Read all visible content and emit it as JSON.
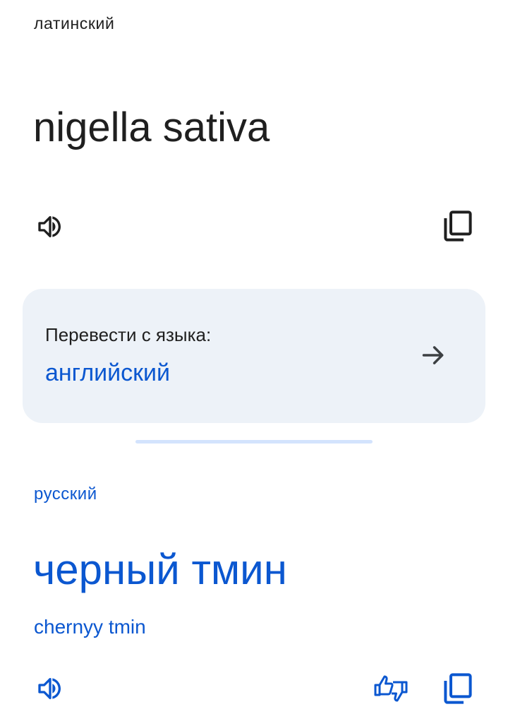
{
  "source": {
    "language": "латинский",
    "text": "nigella sativa",
    "listen_icon": "speaker-icon",
    "copy_icon": "copy-icon"
  },
  "detect": {
    "prompt": "Перевести с языка:",
    "language": "английский",
    "arrow_icon": "arrow-right-icon"
  },
  "target": {
    "language": "русский",
    "text": "черный тмин",
    "transliteration": "chernyy tmin",
    "listen_icon": "speaker-icon",
    "feedback_icon": "thumbs-up-down-icon",
    "copy_icon": "copy-icon"
  },
  "colors": {
    "accent": "#0b57d0",
    "text": "#1f1f1f",
    "card": "#edf2f8",
    "divider": "#d3e3fd"
  }
}
